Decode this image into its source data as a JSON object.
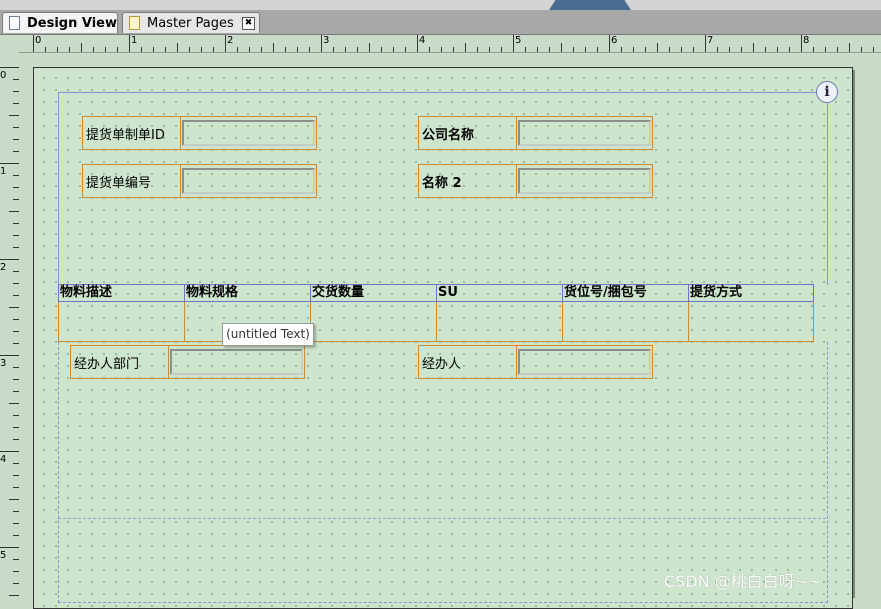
{
  "tabs": [
    {
      "label": "Design View",
      "active": true,
      "icon": "page-icon"
    },
    {
      "label": "Master Pages",
      "active": false,
      "icon": "page-icon",
      "close": "✖"
    }
  ],
  "ruler": {
    "h_numbers": [
      "0",
      "1",
      "2",
      "3",
      "4",
      "5",
      "6",
      "7",
      "8"
    ],
    "v_numbers": [
      "0",
      "1",
      "2",
      "3",
      "4",
      "5"
    ]
  },
  "header_fields": [
    {
      "label": "提货单制单ID",
      "bold": false
    },
    {
      "label": "公司名称",
      "bold": true
    },
    {
      "label": "提货单编号",
      "bold": false
    },
    {
      "label": "名称 2",
      "bold": true
    }
  ],
  "table": {
    "columns": [
      "物料描述",
      "物料规格",
      "交货数量",
      "SU",
      "货位号/捆包号",
      "提货方式"
    ]
  },
  "footer_fields": [
    {
      "label": "经办人部门"
    },
    {
      "label": "经办人"
    }
  ],
  "tooltip": "(untitled Text)",
  "info_icon": "i",
  "watermark": "CSDN @桃白白呀~~",
  "colors": {
    "canvas": "#cde4cd",
    "field_border": "#d08a28",
    "band_border": "#8d8fd6"
  }
}
